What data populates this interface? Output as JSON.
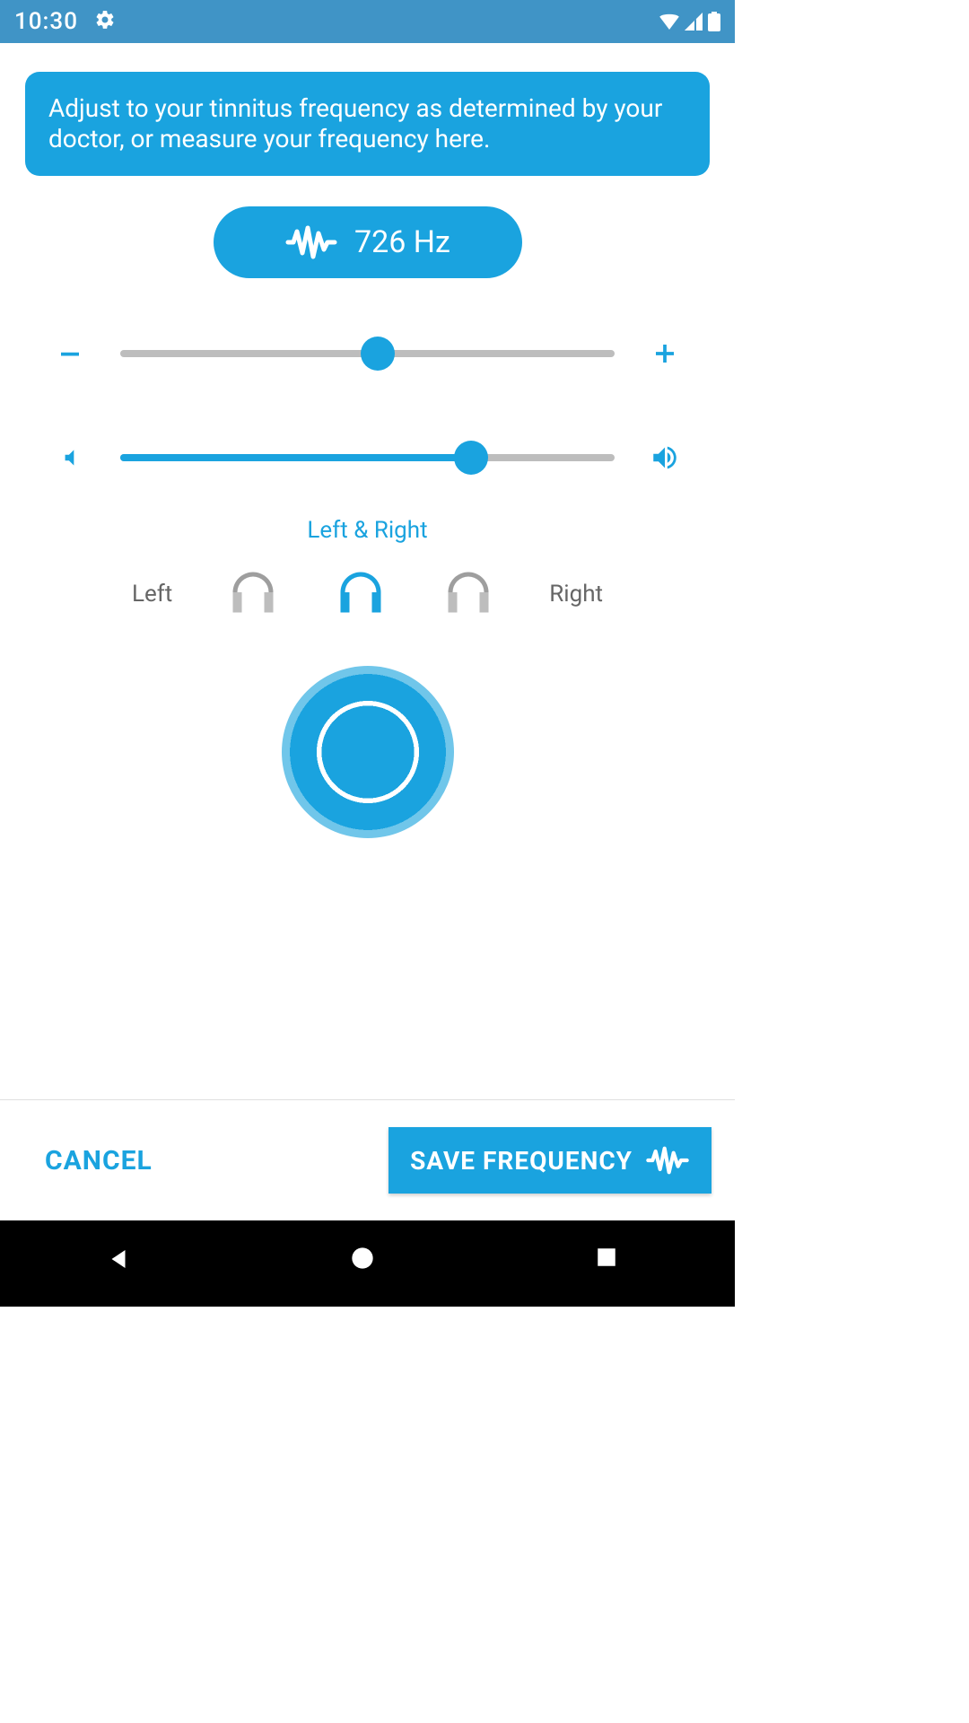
{
  "status_bar": {
    "time": "10:30"
  },
  "banner": {
    "text": "Adjust to your tinnitus frequency as determined by your doctor, or measure your frequency here."
  },
  "frequency": {
    "display": "726 Hz",
    "slider_percent": 52
  },
  "volume": {
    "slider_percent": 71
  },
  "channel": {
    "selected_label": "Left & Right",
    "left_label": "Left",
    "right_label": "Right"
  },
  "footer": {
    "cancel_label": "CANCEL",
    "save_label": "SAVE FREQUENCY"
  }
}
